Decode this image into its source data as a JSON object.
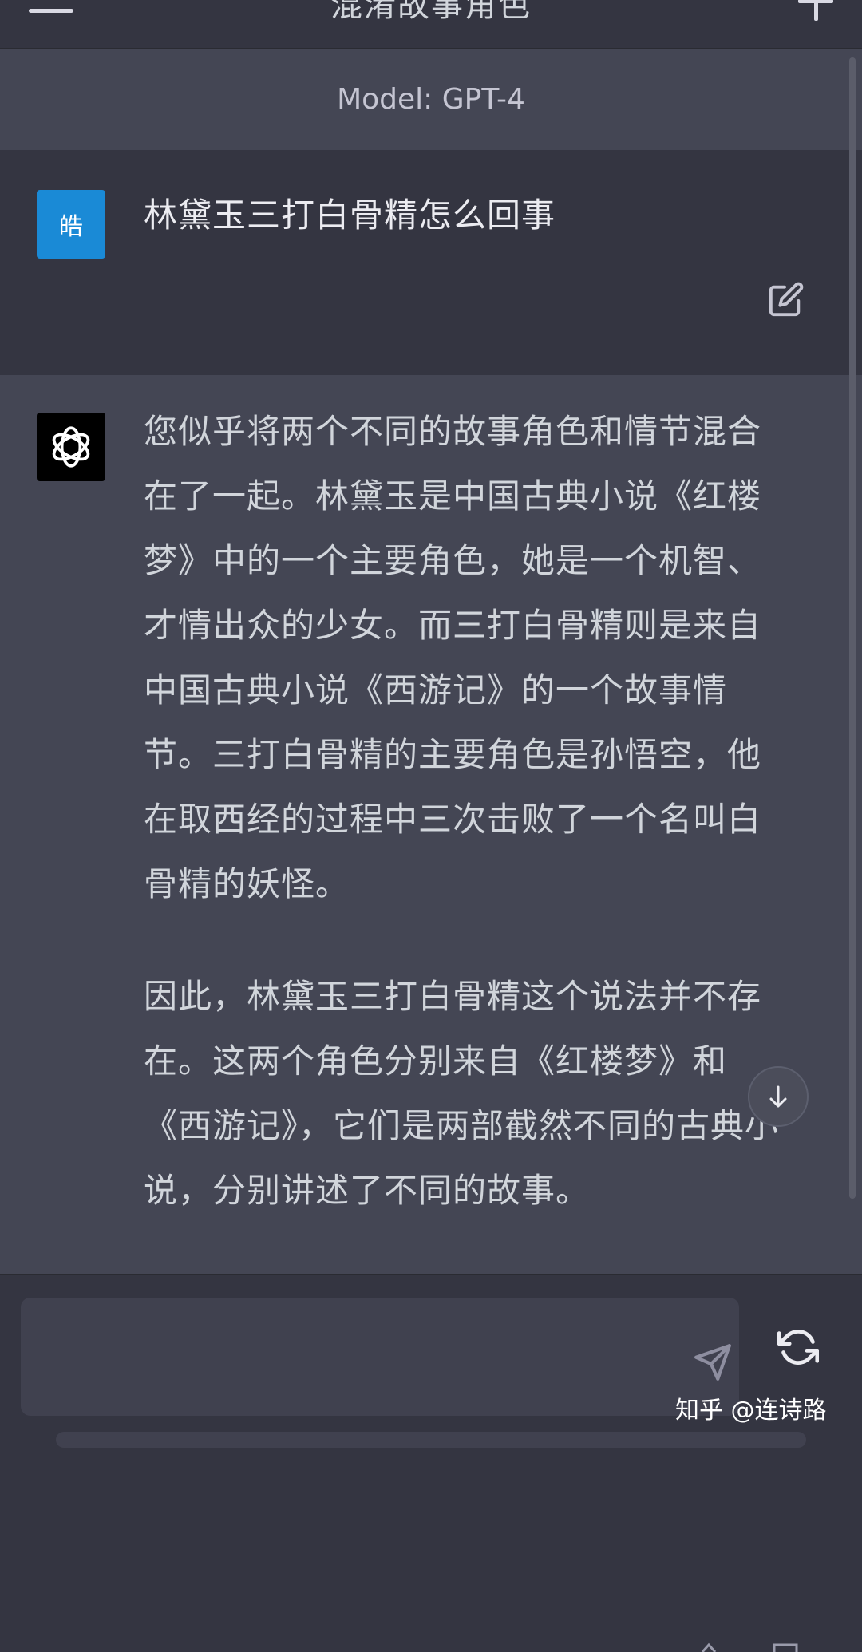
{
  "header": {
    "title": "混淆故事角色",
    "menu_icon": "hamburger-menu-icon",
    "new_chat_icon": "plus-icon"
  },
  "model_banner": {
    "text": "Model: GPT-4"
  },
  "conversation": {
    "user": {
      "avatar_text": "皓",
      "avatar_color": "#1a8ad6",
      "message": "林黛玉三打白骨精怎么回事"
    },
    "assistant": {
      "avatar_icon": "openai-logo-icon",
      "paragraphs": [
        "您似乎将两个不同的故事角色和情节混合在了一起。林黛玉是中国古典小说《红楼梦》中的一个主要角色，她是一个机智、才情出众的少女。而三打白骨精则是来自中国古典小说《西游记》的一个故事情节。三打白骨精的主要角色是孙悟空，他在取西经的过程中三次击败了一个名叫白骨精的妖怪。",
        "因此，林黛玉三打白骨精这个说法并不存在。这两个角色分别来自《红楼梦》和《西游记》，它们是两部截然不同的古典小说，分别讲述了不同的故事。"
      ]
    }
  },
  "composer": {
    "placeholder": "",
    "send_icon": "send-icon",
    "regenerate_icon": "regenerate-icon"
  },
  "watermark": {
    "text": "知乎 @连诗路"
  },
  "colors": {
    "background": "#343541",
    "assistant_bg": "#444654",
    "input_bg": "#40414f"
  }
}
